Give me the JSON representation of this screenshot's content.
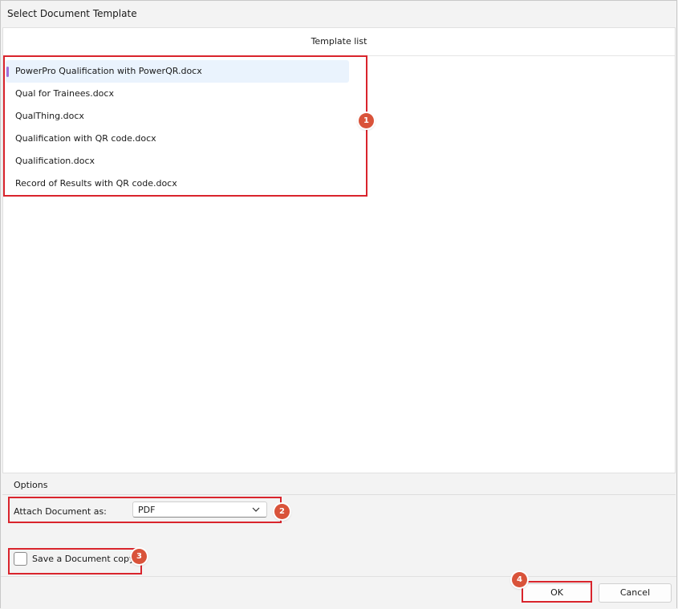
{
  "window": {
    "title": "Select Document Template"
  },
  "template_list": {
    "header": "Template list",
    "items": [
      {
        "label": "PowerPro Qualification with PowerQR.docx",
        "selected": true
      },
      {
        "label": "Qual for Trainees.docx"
      },
      {
        "label": "QualThing.docx"
      },
      {
        "label": "Qualification with QR code.docx"
      },
      {
        "label": "Qualification.docx"
      },
      {
        "label": "Record of Results with QR code.docx"
      }
    ]
  },
  "options": {
    "header": "Options",
    "attach_label": "Attach Document as:",
    "attach_value": "PDF",
    "save_copy_label": "Save a Document copy",
    "save_copy_checked": false
  },
  "buttons": {
    "ok": "OK",
    "cancel": "Cancel"
  },
  "annotations": {
    "badges": [
      "1",
      "2",
      "3",
      "4"
    ],
    "color": "#d9242c",
    "badge_color": "#d9533a"
  },
  "icons": {
    "dropdown": "chevron-down-icon"
  }
}
